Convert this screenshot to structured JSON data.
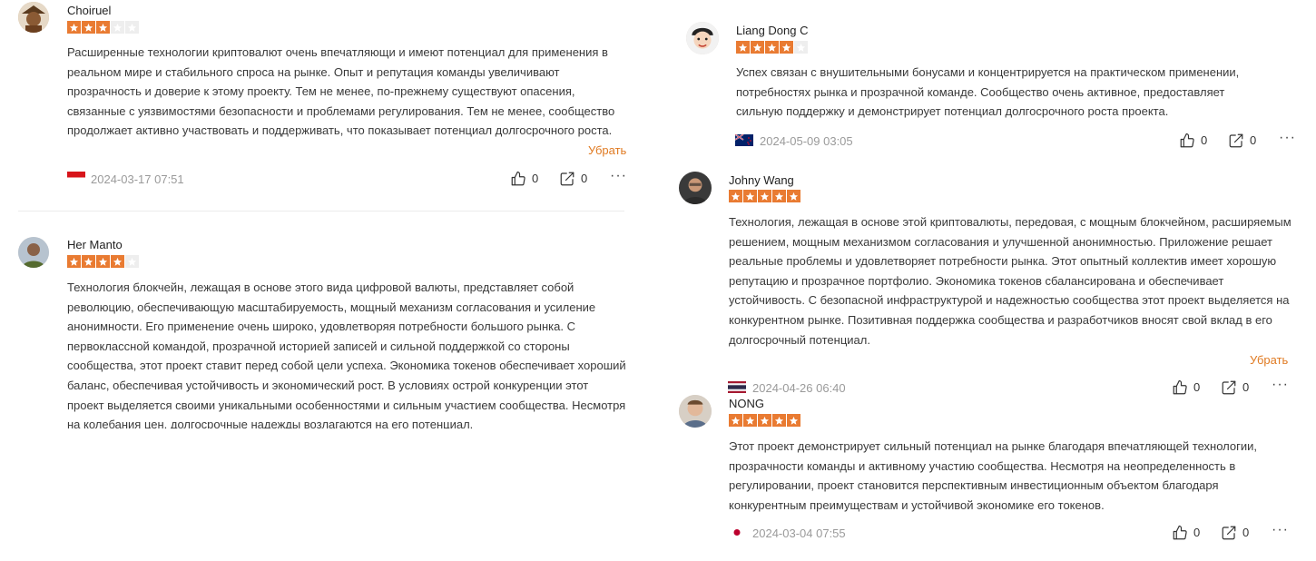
{
  "colors": {
    "star_active": "#e97b32",
    "star_inactive": "#eeeeee",
    "collapse_link": "#e07a22",
    "date_text": "#9a9a9a"
  },
  "reviews": [
    {
      "author": "Choiruel",
      "rating": 3,
      "text": "Расширенные технологии криптовалют очень впечатляющи и имеют потенциал для применения в реальном мире и стабильного спроса на рынке. Опыт и репутация команды увеличивают прозрачность и доверие к этому проекту. Тем не менее, по-прежнему существуют опасения, связанные с уязвимостями безопасности и проблемами регулирования. Тем не менее, сообщество продолжает активно участвовать и поддерживать, что показывает потенциал долгосрочного роста.",
      "collapse_label": "Убрать",
      "flag_icon": "indonesia-flag-icon",
      "date": "2024-03-17 07:51",
      "likes": "0",
      "shares": "0"
    },
    {
      "author": "Her Manto",
      "rating": 4,
      "text": "Технология блокчейн, лежащая в основе этого вида цифровой валюты, представляет собой революцию, обеспечивающую масштабируемость, мощный механизм согласования и усиление анонимности. Его применение очень широко, удовлетворяя потребности большого рынка. С первоклассной командой, прозрачной историей записей и сильной поддержкой со стороны сообщества, этот проект ставит перед собой цели успеха. Экономика токенов обеспечивает хороший баланс, обеспечивая устойчивость и экономический рост. В условиях острой конкуренции этот проект выделяется своими уникальными особенностями и сильным участием сообщества. Несмотря на колебания цен, долгосрочные надежды возлагаются на его потенциал."
    },
    {
      "author": "Liang Dong C",
      "rating": 4,
      "text": "Успех связан с внушительными бонусами и концентрируется на практическом применении, потребностях рынка и прозрачной команде. Сообщество очень активное, предоставляет сильную поддержку и демонстрирует потенциал долгосрочного роста проекта.",
      "flag_icon": "new-zealand-flag-icon",
      "date": "2024-05-09 03:05",
      "likes": "0",
      "shares": "0"
    },
    {
      "author": "Johny Wang",
      "rating": 5,
      "text": "Технология, лежащая в основе этой криптовалюты, передовая, с мощным блокчейном, расширяемым решением, мощным механизмом согласования и улучшенной анонимностью. Приложение решает реальные проблемы и удовлетворяет потребности рынка. Этот опытный коллектив имеет хорошую репутацию и прозрачное портфолио. Экономика токенов сбалансирована и обеспечивает устойчивость. С безопасной инфраструктурой и надежностью сообщества этот проект выделяется на конкурентном рынке. Позитивная поддержка сообщества и разработчиков вносят свой вклад в его долгосрочный потенциал.",
      "collapse_label": "Убрать",
      "flag_icon": "thailand-flag-icon",
      "date": "2024-04-26 06:40",
      "likes": "0",
      "shares": "0"
    },
    {
      "author": "NONG",
      "rating": 5,
      "text": "Этот проект демонстрирует сильный потенциал на рынке благодаря впечатляющей технологии, прозрачности команды и активному участию сообщества. Несмотря на неопределенность в регулировании, проект становится перспективным инвестиционным объектом благодаря конкурентным преимуществам и устойчивой экономике его токенов.",
      "flag_icon": "japan-flag-icon",
      "date": "2024-03-04 07:55",
      "likes": "0",
      "shares": "0"
    }
  ]
}
